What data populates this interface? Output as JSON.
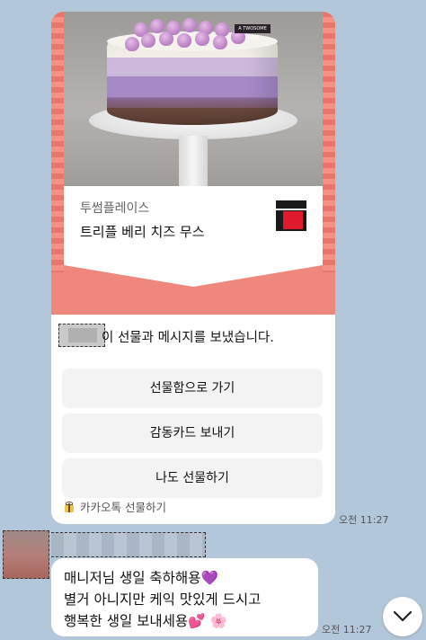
{
  "gift_card": {
    "brand": "투썸플레이스",
    "product": "트리플 베리 치즈 무스",
    "cake_label": "A TWOSOME PLACE",
    "sent_message": "이 선물과 메시지를 보냈습니다.",
    "buttons": [
      {
        "label": "선물함으로 가기"
      },
      {
        "label": "감동카드 보내기"
      },
      {
        "label": "나도 선물하기"
      }
    ],
    "footer": "카카오톡 선물하기",
    "time": "오전 11:27",
    "icons": {
      "gift": "gift-icon",
      "logo": "brand-logo-icon"
    },
    "colors": {
      "hero": "#f0877c",
      "background": "#b2c7d9"
    }
  },
  "message": {
    "lines": [
      "매니저님 생일 축하해용",
      "별거 아니지만 케익 맛있게 드시고",
      "행복한 생일 보내세용"
    ],
    "emoji_1": "💜",
    "emoji_2a": "💕",
    "emoji_2b": "🌸",
    "time": "오전 11:27"
  },
  "scroll_button": {
    "icon": "chevron-down-icon"
  }
}
